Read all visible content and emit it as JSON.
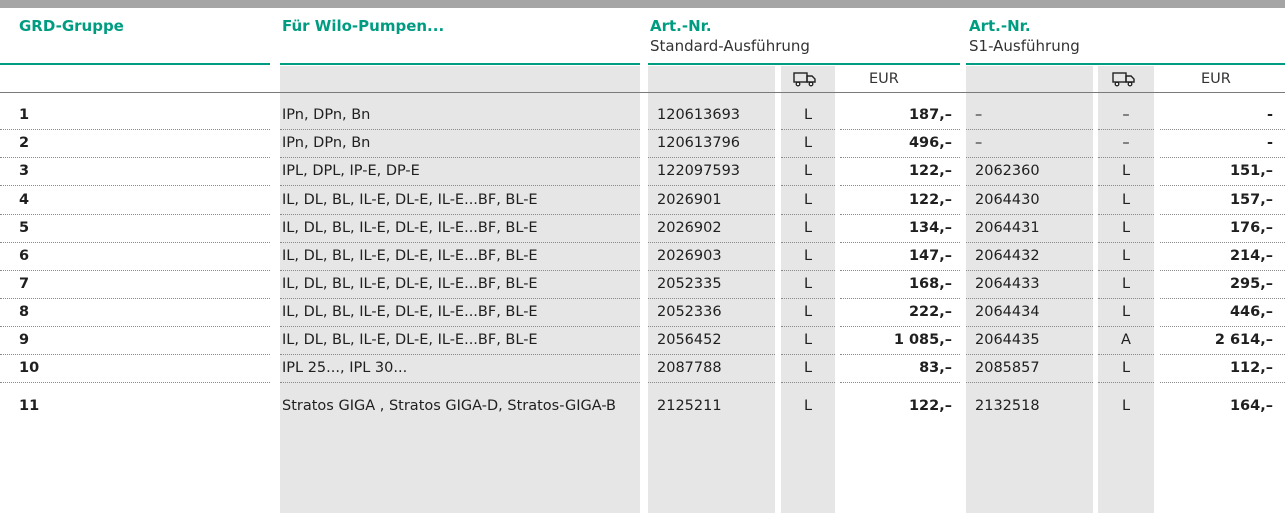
{
  "table": {
    "headers": {
      "group": "GRD-Gruppe",
      "pumps": "Für Wilo-Pumpen...",
      "art_std": "Art.-Nr.",
      "art_std_sub": "Standard-Ausführung",
      "art_s1": "Art.-Nr.",
      "art_s1_sub": "S1-Ausführung",
      "currency_std": "EUR",
      "currency_s1": "EUR",
      "delivery_icon": "truck-icon"
    },
    "rows": [
      {
        "group": "1",
        "pumps": "IPn, DPn, Bn",
        "std_no": "120613693",
        "std_avail": "L",
        "std_price": "187,–",
        "s1_no": "–",
        "s1_avail": "–",
        "s1_price": "-"
      },
      {
        "group": "2",
        "pumps": "IPn, DPn, Bn",
        "std_no": "120613796",
        "std_avail": "L",
        "std_price": "496,–",
        "s1_no": "–",
        "s1_avail": "–",
        "s1_price": "-"
      },
      {
        "group": "3",
        "pumps": "IPL, DPL, IP-E, DP-E",
        "std_no": "122097593",
        "std_avail": "L",
        "std_price": "122,–",
        "s1_no": "2062360",
        "s1_avail": "L",
        "s1_price": "151,–"
      },
      {
        "group": "4",
        "pumps": "IL, DL, BL, IL-E, DL-E, IL-E...BF, BL-E",
        "std_no": "2026901",
        "std_avail": "L",
        "std_price": "122,–",
        "s1_no": "2064430",
        "s1_avail": "L",
        "s1_price": "157,–"
      },
      {
        "group": "5",
        "pumps": "IL, DL, BL, IL-E, DL-E, IL-E...BF, BL-E",
        "std_no": "2026902",
        "std_avail": "L",
        "std_price": "134,–",
        "s1_no": "2064431",
        "s1_avail": "L",
        "s1_price": "176,–"
      },
      {
        "group": "6",
        "pumps": "IL, DL, BL, IL-E, DL-E, IL-E...BF, BL-E",
        "std_no": "2026903",
        "std_avail": "L",
        "std_price": "147,–",
        "s1_no": "2064432",
        "s1_avail": "L",
        "s1_price": "214,–"
      },
      {
        "group": "7",
        "pumps": "IL, DL, BL, IL-E, DL-E, IL-E...BF, BL-E",
        "std_no": "2052335",
        "std_avail": "L",
        "std_price": "168,–",
        "s1_no": "2064433",
        "s1_avail": "L",
        "s1_price": "295,–"
      },
      {
        "group": "8",
        "pumps": "IL, DL, BL, IL-E, DL-E, IL-E...BF, BL-E",
        "std_no": "2052336",
        "std_avail": "L",
        "std_price": "222,–",
        "s1_no": "2064434",
        "s1_avail": "L",
        "s1_price": "446,–"
      },
      {
        "group": "9",
        "pumps": "IL, DL, BL, IL-E, DL-E, IL-E...BF, BL-E",
        "std_no": "2056452",
        "std_avail": "L",
        "std_price": "1 085,–",
        "s1_no": "2064435",
        "s1_avail": "A",
        "s1_price": "2 614,–"
      },
      {
        "group": "10",
        "pumps": "IPL 25..., IPL 30...",
        "std_no": "2087788",
        "std_avail": "L",
        "std_price": "83,–",
        "s1_no": "2085857",
        "s1_avail": "L",
        "s1_price": "112,–"
      },
      {
        "group": "11",
        "pumps": "Stratos GIGA , Stratos GIGA-D, Stratos-GIGA-B",
        "std_no": "2125211",
        "std_avail": "L",
        "std_price": "122,–",
        "s1_no": "2132518",
        "s1_avail": "L",
        "s1_price": "164,–"
      }
    ]
  },
  "colors": {
    "accent": "#009c82",
    "shade": "#e6e6e6",
    "topbar": "#a5a5a5"
  }
}
